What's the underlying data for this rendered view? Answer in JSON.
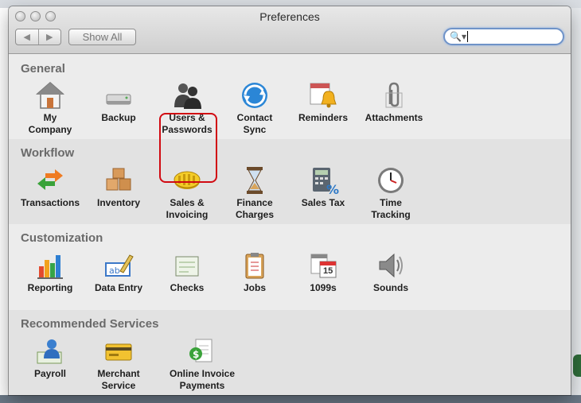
{
  "window": {
    "title": "Preferences",
    "back_arrow": "◀",
    "forward_arrow": "▶",
    "show_all_label": "Show All",
    "search_placeholder": "",
    "search_glyph": "🔍▾"
  },
  "sections": [
    {
      "title": "General",
      "items": [
        {
          "label": "My\nCompany",
          "icon": "house-icon"
        },
        {
          "label": "Backup",
          "icon": "drive-icon"
        },
        {
          "label": "Users &\nPasswords",
          "icon": "users-icon"
        },
        {
          "label": "Contact\nSync",
          "icon": "sync-icon"
        },
        {
          "label": "Reminders",
          "icon": "bell-calendar-icon"
        },
        {
          "label": "Attachments",
          "icon": "paperclip-icon"
        }
      ]
    },
    {
      "title": "Workflow",
      "items": [
        {
          "label": "Transactions",
          "icon": "arrows-icon"
        },
        {
          "label": "Inventory",
          "icon": "boxes-icon"
        },
        {
          "label": "Sales &\nInvoicing",
          "icon": "coins-icon"
        },
        {
          "label": "Finance\nCharges",
          "icon": "hourglass-icon"
        },
        {
          "label": "Sales Tax",
          "icon": "calculator-icon"
        },
        {
          "label": "Time\nTracking",
          "icon": "clock-icon"
        }
      ]
    },
    {
      "title": "Customization",
      "items": [
        {
          "label": "Reporting",
          "icon": "bar-chart-icon"
        },
        {
          "label": "Data Entry",
          "icon": "data-entry-icon"
        },
        {
          "label": "Checks",
          "icon": "check-icon"
        },
        {
          "label": "Jobs",
          "icon": "clipboard-icon"
        },
        {
          "label": "1099s",
          "icon": "calendar-icon"
        },
        {
          "label": "Sounds",
          "icon": "speaker-icon"
        }
      ]
    },
    {
      "title": "Recommended Services",
      "items": [
        {
          "label": "Payroll",
          "icon": "payroll-icon"
        },
        {
          "label": "Merchant\nService",
          "icon": "credit-card-icon"
        },
        {
          "label": "Online Invoice\nPayments",
          "icon": "invoice-icon"
        }
      ]
    }
  ],
  "calendar_day": "15",
  "highlighted_item": "Sales &\nInvoicing"
}
